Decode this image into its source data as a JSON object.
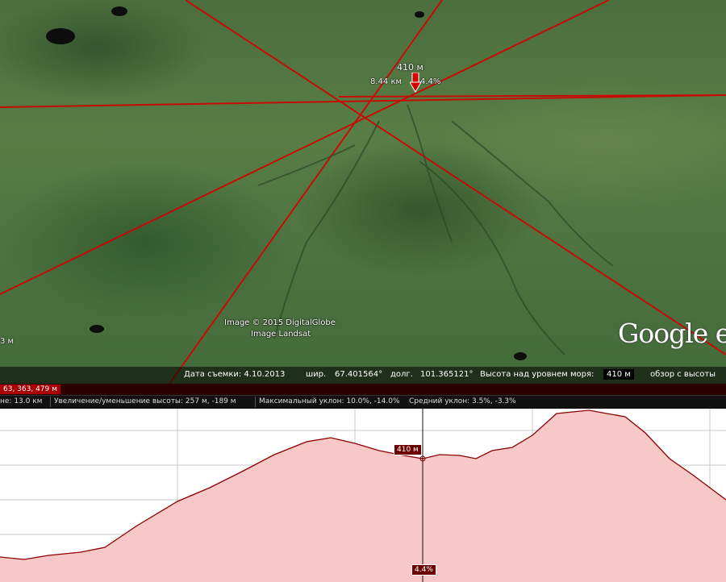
{
  "map": {
    "point_elevation": "410 м",
    "point_distance": "8.44 км",
    "point_slope": "4.4%",
    "credit_line1": "Image © 2015 DigitalGlobe",
    "credit_line2": "Image Landsat",
    "left_edge_label": "3 м",
    "logo": "Google e",
    "accent_color": "#d40000"
  },
  "status": {
    "date_label": "Дата съемки: 4.10.2013",
    "lat_label": "шир.",
    "lat_value": "67.401564°",
    "lon_label": "долг.",
    "lon_value": "101.365121°",
    "alt_label": "Высота над уровнем моря:",
    "alt_value": "410 м",
    "view_label": "обзор с высоты"
  },
  "profile_header": {
    "range_tag": "63, 363, 479 м"
  },
  "stats": {
    "distance": "не: 13.0 км",
    "gain_loss": "Увеличение/уменьшение высоты: 257 м, -189 м",
    "max_slope": "Максимальный уклон: 10.0%, -14.0%",
    "avg_slope": "Средний уклон: 3.5%, -3.3%"
  },
  "profile": {
    "cursor_elevation": "410 м",
    "cursor_slope": "4.4%",
    "fill_color": "#f8c8c8",
    "line_color": "#8a0000"
  }
}
